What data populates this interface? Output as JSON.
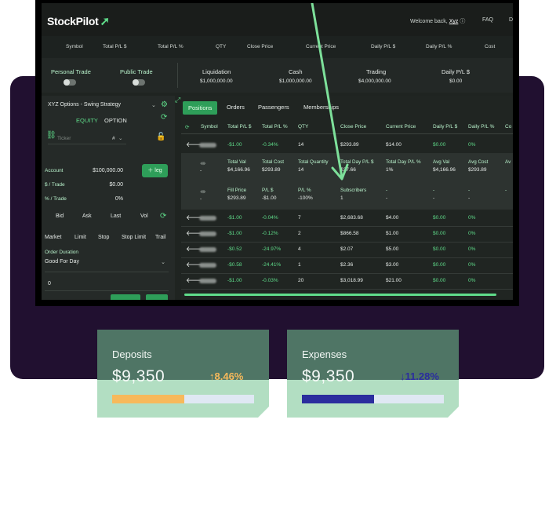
{
  "app": {
    "brand": "StockPilot",
    "welcome_text": "Welcome back,",
    "username": "Xyz",
    "faq": "FAQ",
    "more": "D"
  },
  "ticker_header": [
    "Symbol",
    "Total P/L $",
    "Total P/L %",
    "QTY",
    "Close Price",
    "Current Price",
    "Daily P/L $",
    "Daily P/L %",
    "Cost"
  ],
  "toolbar": {
    "personal_trade": "Personal Trade",
    "public_trade": "Public Trade",
    "liquidation_label": "Liquidation",
    "liquidation_value": "$1,000,000.00",
    "cash_label": "Cash",
    "cash_value": "$1,000,000.00",
    "trading_label": "Trading",
    "trading_value": "$4,000,000.00",
    "daily_pl_label": "Daily P/L $",
    "daily_pl_value": "$0.00"
  },
  "left_panel": {
    "strategy": "XYZ Options - Swing Strategy",
    "equity": "EQUITY",
    "option": "OPTION",
    "ticker_placeholder": "Ticker",
    "hash": "#",
    "account_label": "Account",
    "account_value": "$100,000.00",
    "per_trade_dollar_label": "$ / Trade",
    "per_trade_dollar_value": "$0.00",
    "per_trade_pct_label": "% / Trade",
    "per_trade_pct_value": "0%",
    "leg_button": "leg",
    "quote_tabs": [
      "Bid",
      "Ask",
      "Last",
      "Vol"
    ],
    "order_types": [
      "Market",
      "Limit",
      "Stop",
      "Stop Limit",
      "Trail"
    ],
    "order_duration_label": "Order Duration",
    "order_duration_value": "Good For Day",
    "quantity_value": "0"
  },
  "tabs": [
    "Positions",
    "Orders",
    "Passengers",
    "Memberships"
  ],
  "table": {
    "headers": [
      "Symbol",
      "Total P/L $",
      "Total P/L %",
      "QTY",
      "Close Price",
      "Current Price",
      "Daily P/L $",
      "Daily P/L %",
      "Co"
    ],
    "rows_top": [
      [
        "-$1.00",
        "-0.34%",
        "14",
        "$293.89",
        "$14.00",
        "$0.00",
        "0%"
      ]
    ],
    "detail": {
      "labels1": [
        "Total Val",
        "Total Cost",
        "Total Quantity",
        "Total Day P/L $",
        "Total Day P/L %",
        "Avg Val",
        "Avg Cost",
        "Av"
      ],
      "values1": [
        "$4,166.96",
        "$293.89",
        "14",
        "$37.66",
        "1%",
        "$4,166.96",
        "$293.89"
      ],
      "labels2": [
        "Fill Price",
        "P/L $",
        "P/L %",
        "Subscribers",
        "-",
        "-",
        "-",
        "-"
      ],
      "values2": [
        "$293.89",
        "-$1.00",
        "-100%",
        "1",
        "-",
        "-",
        "-"
      ]
    },
    "rows_bottom": [
      [
        "-$1.00",
        "-0.04%",
        "7",
        "$2,683.68",
        "$4.00",
        "$0.00",
        "0%"
      ],
      [
        "-$1.00",
        "-0.12%",
        "2",
        "$866.58",
        "$1.00",
        "$0.00",
        "0%"
      ],
      [
        "-$0.52",
        "-24.97%",
        "4",
        "$2.07",
        "$5.00",
        "$0.00",
        "0%"
      ],
      [
        "-$0.58",
        "-24.41%",
        "1",
        "$2.36",
        "$3.00",
        "$0.00",
        "0%"
      ],
      [
        "-$1.00",
        "-0.03%",
        "20",
        "$3,018.99",
        "$21.00",
        "$0.00",
        "0%"
      ]
    ]
  },
  "cards": {
    "deposits": {
      "title": "Deposits",
      "amount": "$9,350",
      "change": "8.46%",
      "arrow": "↑",
      "fill": 0.51,
      "fill_color": "#f7b95b",
      "change_color": "#f7b95b"
    },
    "expenses": {
      "title": "Expenses",
      "amount": "$9,350",
      "change": "11.28%",
      "arrow": "↓",
      "fill": 0.51,
      "fill_color": "#2b2d9e",
      "change_color": "#2b2d9e"
    }
  },
  "colors": {
    "accent": "#5fdc8a",
    "brand_purple": "#211030",
    "card_green": "#4f7565"
  }
}
